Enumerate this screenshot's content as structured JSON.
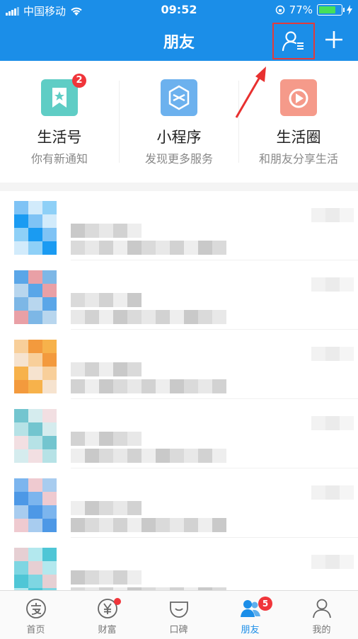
{
  "status_bar": {
    "carrier": "中国移动",
    "time": "09:52",
    "battery": "77%",
    "battery_level_percent": 77
  },
  "nav_bar": {
    "title": "朋友",
    "contacts_icon": "contacts-list-icon",
    "add_icon": "plus-icon"
  },
  "services": [
    {
      "name": "生活号",
      "subtitle": "你有新通知",
      "badge": "2",
      "color": "#5fcdc5",
      "icon": "bookmark-star-icon"
    },
    {
      "name": "小程序",
      "subtitle": "发现更多服务",
      "color": "#6cb1ee",
      "icon": "mini-program-icon"
    },
    {
      "name": "生活圈",
      "subtitle": "和朋友分享生活",
      "color": "#f59a8a",
      "icon": "play-circle-icon"
    }
  ],
  "tab_bar": [
    {
      "label": "首页",
      "icon": "alipay-home-icon"
    },
    {
      "label": "财富",
      "icon": "yuan-icon",
      "dot": true
    },
    {
      "label": "口碑",
      "icon": "koubei-icon"
    },
    {
      "label": "朋友",
      "icon": "friends-icon",
      "badge": "5",
      "active": true
    },
    {
      "label": "我的",
      "icon": "profile-icon"
    }
  ],
  "colors": {
    "brand_blue": "#1b8ee8",
    "badge_red": "#f0353a",
    "highlight_red": "#e23b3b"
  }
}
